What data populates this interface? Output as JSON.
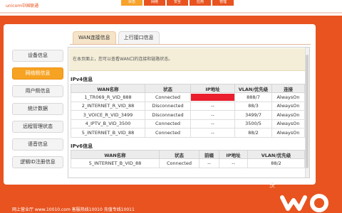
{
  "header": {
    "brand": "unicom中国联通",
    "top_tabs": [
      "状态",
      "网络",
      "安全",
      "应用",
      "管理"
    ]
  },
  "sidebar": {
    "items": [
      {
        "label": "设备信息",
        "active": false
      },
      {
        "label": "网络侧信息",
        "active": true
      },
      {
        "label": "用户侧信息",
        "active": false
      },
      {
        "label": "统计数据",
        "active": false
      },
      {
        "label": "远程管理状态",
        "active": false
      },
      {
        "label": "语音信息",
        "active": false
      },
      {
        "label": "逻辑ID注册信息",
        "active": false
      }
    ]
  },
  "tabs": [
    {
      "label": "WAN连接信息",
      "active": true
    },
    {
      "label": "上行接口信息",
      "active": false
    }
  ],
  "notice": "在本页面上，您可以查看WAN口的连接和链路状态。",
  "ipv4": {
    "title": "IPv4信息",
    "headers": [
      "WAN名称",
      "状态",
      "IP地址",
      "VLAN/优先级",
      "连接"
    ],
    "rows": [
      [
        "1_TR069_R_VID_888",
        "Connected",
        "",
        "888/7",
        "AlwaysOn"
      ],
      [
        "2_INTERNET_R_VID_88",
        "Disconnected",
        "--",
        "88/3",
        "AlwaysOn"
      ],
      [
        "3_VOICE_R_VID_3499",
        "Disconnected",
        "--",
        "3499/7",
        "AlwaysOn"
      ],
      [
        "4_IPTV_B_VID_3500",
        "Connected",
        "--",
        "3500/5",
        "AlwaysOn"
      ],
      [
        "5_INTERNET_B_VID_88",
        "Connected",
        "--",
        "88/2",
        "AlwaysOn"
      ]
    ]
  },
  "ipv6": {
    "title": "IPv6信息",
    "headers": [
      "WAN名称",
      "状态",
      "前缀",
      "IP地址",
      "VLAN/优先级"
    ],
    "rows": [
      [
        "5_INTERNET_B_VID_88",
        "Connected",
        "--",
        "--",
        "88/2"
      ]
    ]
  },
  "footer": {
    "text": "网上营业厅 www.10010.com   客服热线10010   充值专线10011"
  },
  "colors": {
    "brand_orange": "#e8531f",
    "active_menu": "#f6a323",
    "mask_red": "#ea1e2d"
  }
}
